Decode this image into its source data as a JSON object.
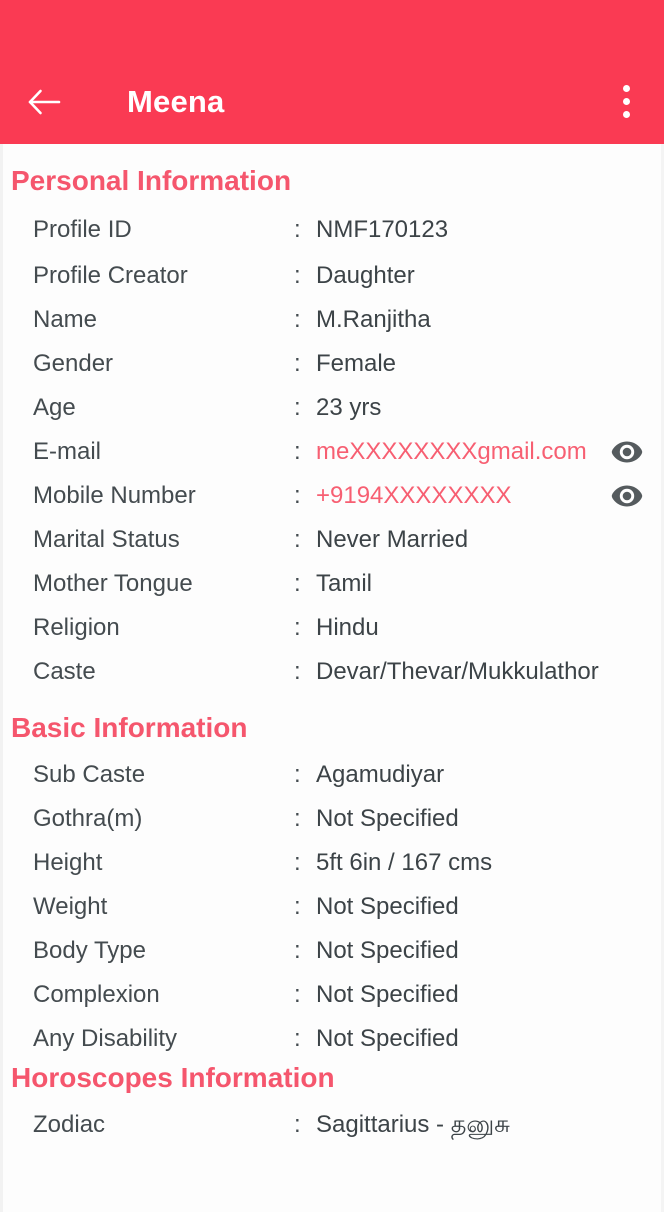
{
  "appbar": {
    "back_icon": "back-arrow-icon",
    "title": "Meena",
    "menu_icon": "overflow-menu-icon",
    "background_color": "#fa3a53"
  },
  "theme": {
    "accent_color": "#f5566d",
    "masked_value_color": "#f75f72",
    "label_color": "#444b4f",
    "value_color": "#3c4347",
    "page_background": "#fdfdfd"
  },
  "sections": [
    {
      "title": "Personal Information",
      "rows": [
        {
          "label": "Profile ID",
          "separator": ":",
          "value": "NMF170123"
        },
        {
          "label": "Profile Creator",
          "separator": ":",
          "value": "Daughter"
        },
        {
          "label": "Name",
          "separator": ":",
          "value": "M.Ranjitha"
        },
        {
          "label": "Gender",
          "separator": ":",
          "value": "Female"
        },
        {
          "label": "Age",
          "separator": ":",
          "value": "23 yrs"
        },
        {
          "label": "E-mail",
          "separator": ":",
          "value": "meXXXXXXXXgmail.com",
          "masked": true,
          "eye_icon": "eye-icon"
        },
        {
          "label": "Mobile Number",
          "separator": ":",
          "value": "+9194XXXXXXXX",
          "masked": true,
          "eye_icon": "eye-icon"
        },
        {
          "label": "Marital Status",
          "separator": ":",
          "value": "Never Married"
        },
        {
          "label": "Mother Tongue",
          "separator": ":",
          "value": "Tamil"
        },
        {
          "label": "Religion",
          "separator": ":",
          "value": "Hindu"
        },
        {
          "label": "Caste",
          "separator": ":",
          "value": "Devar/Thevar/Mukkulathor"
        }
      ]
    },
    {
      "title": "Basic Information",
      "rows": [
        {
          "label": "Sub Caste",
          "separator": ":",
          "value": "Agamudiyar"
        },
        {
          "label": "Gothra(m)",
          "separator": ":",
          "value": "Not Specified"
        },
        {
          "label": "Height",
          "separator": ":",
          "value": "5ft 6in / 167 cms"
        },
        {
          "label": "Weight",
          "separator": ":",
          "value": "Not Specified"
        },
        {
          "label": "Body Type",
          "separator": ":",
          "value": "Not Specified"
        },
        {
          "label": "Complexion",
          "separator": ":",
          "value": "Not Specified"
        },
        {
          "label": "Any Disability",
          "separator": ":",
          "value": "Not Specified"
        }
      ]
    },
    {
      "title": "Horoscopes Information",
      "rows": [
        {
          "label": "Zodiac",
          "separator": ":",
          "value": "Sagittarius - தனுசு"
        }
      ]
    }
  ]
}
